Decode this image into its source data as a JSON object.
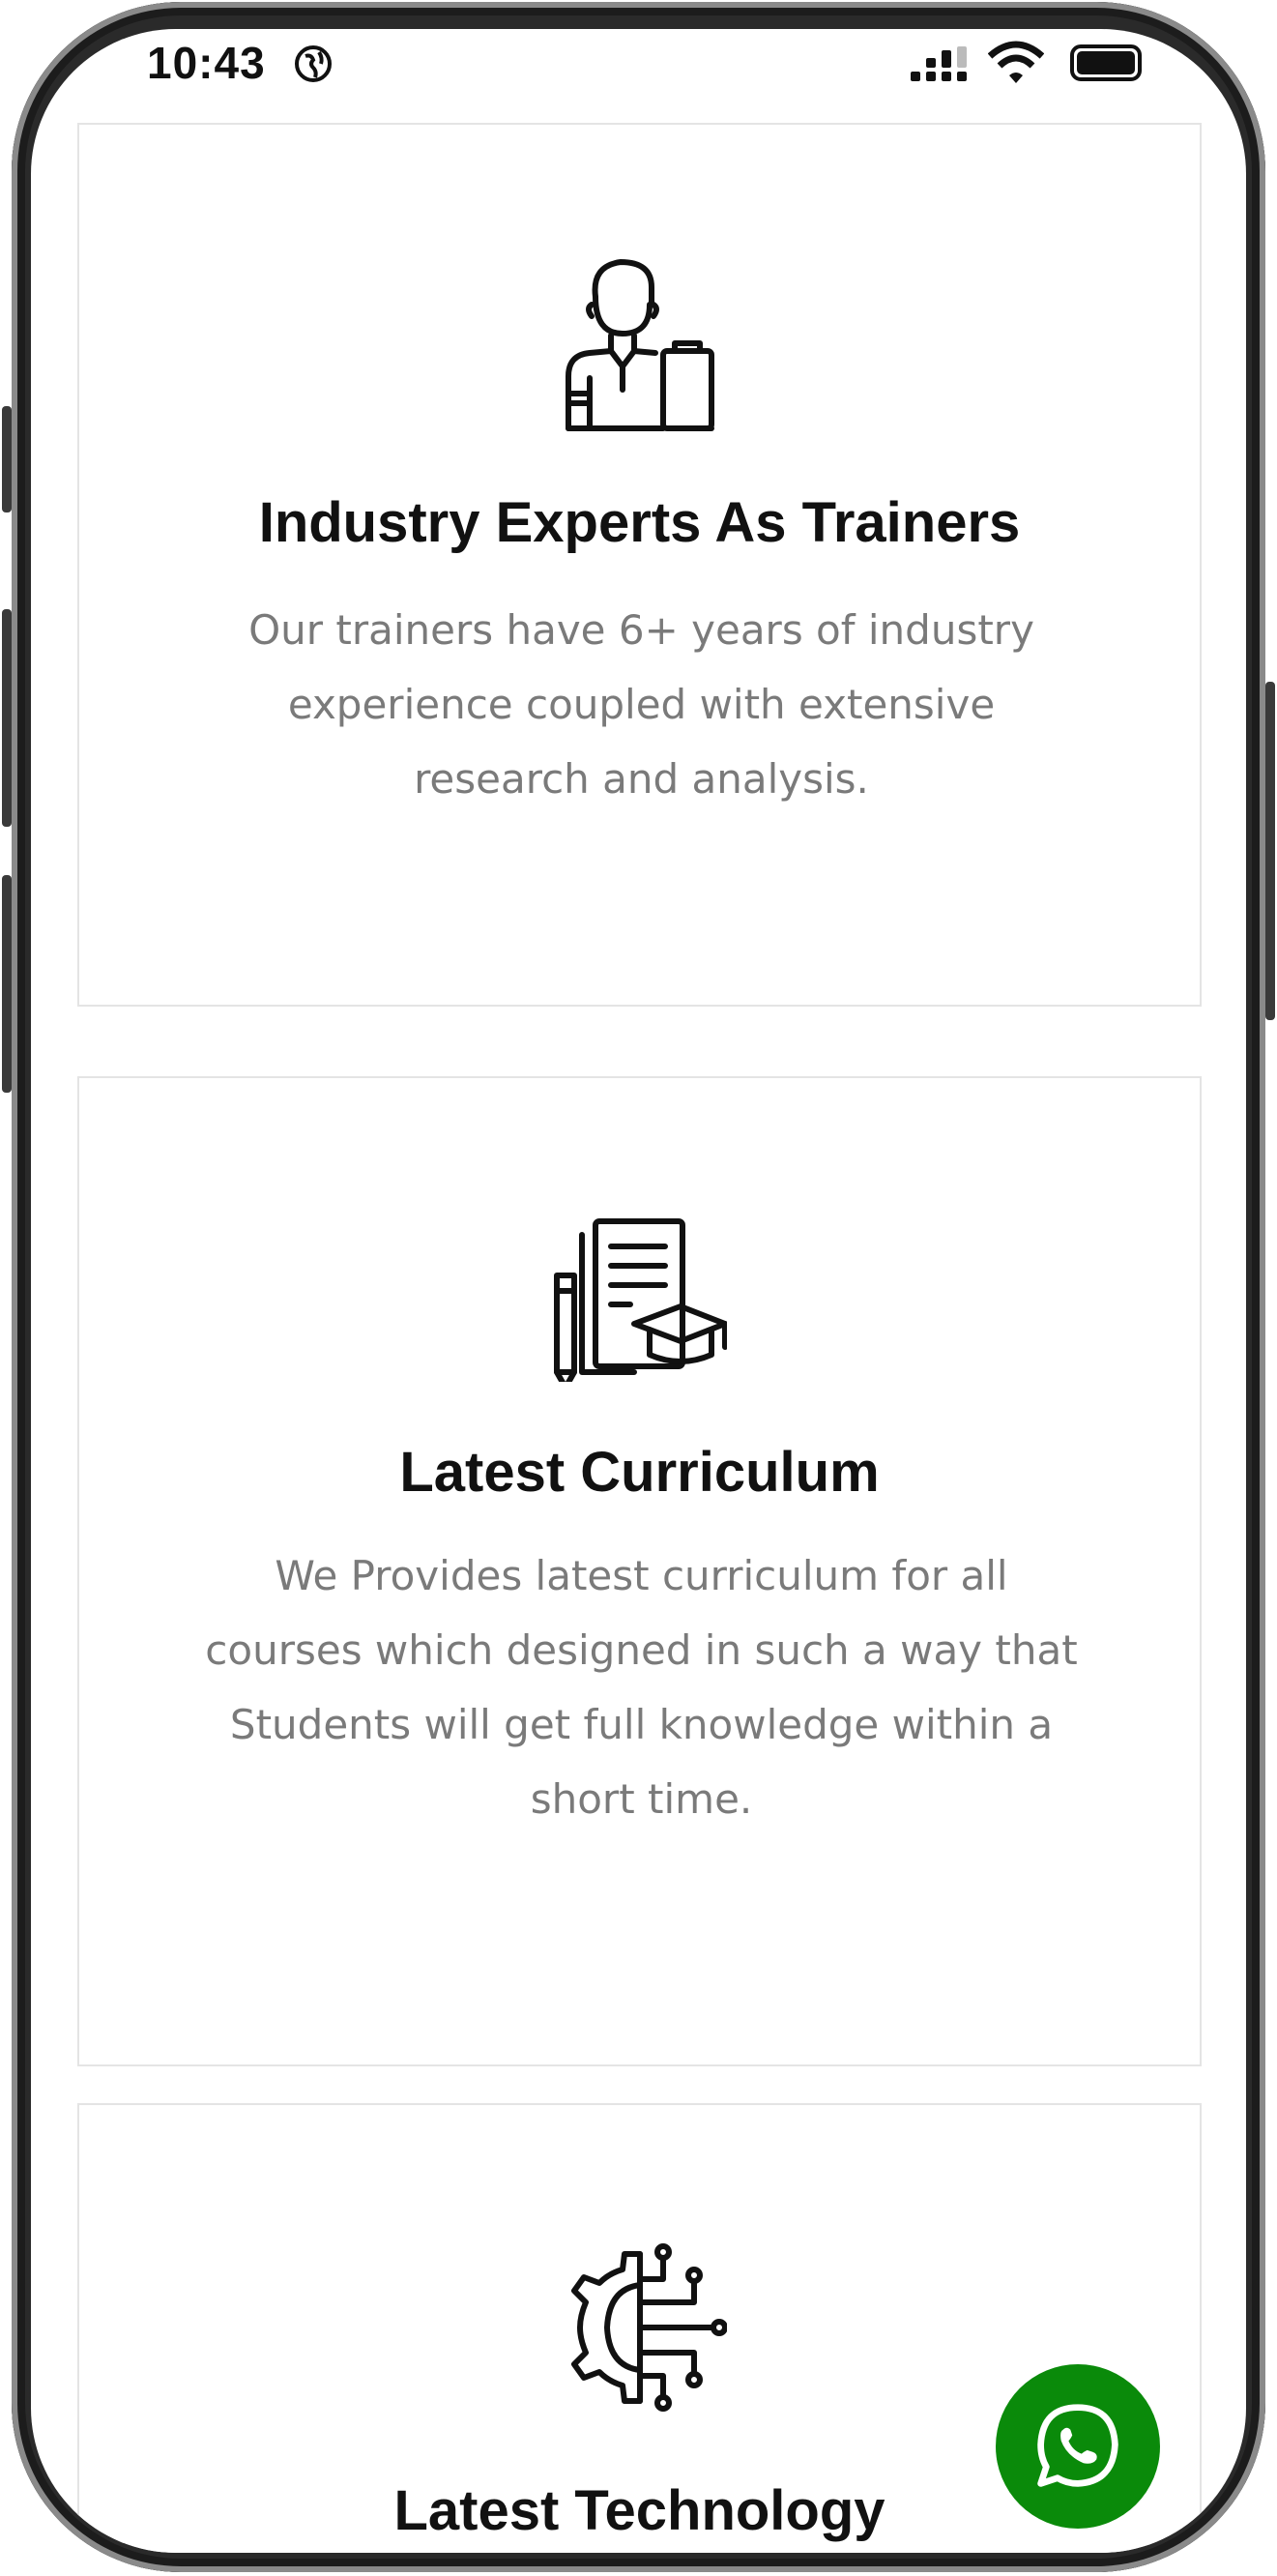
{
  "status_bar": {
    "time": "10:43"
  },
  "cards": [
    {
      "icon": "trainer-icon",
      "title": "Industry Experts As Trainers",
      "description": "Our trainers have 6+ years of industry experience coupled with extensive research and analysis."
    },
    {
      "icon": "curriculum-icon",
      "title": "Latest Curriculum",
      "description": "We Provides latest curriculum for all courses which designed in such a way that Students will get full knowledge within a short time."
    },
    {
      "icon": "technology-gear-icon",
      "title": "Latest Technology",
      "description": ""
    }
  ],
  "floating": {
    "icon": "whatsapp-icon",
    "color": "#0a8a0a"
  }
}
